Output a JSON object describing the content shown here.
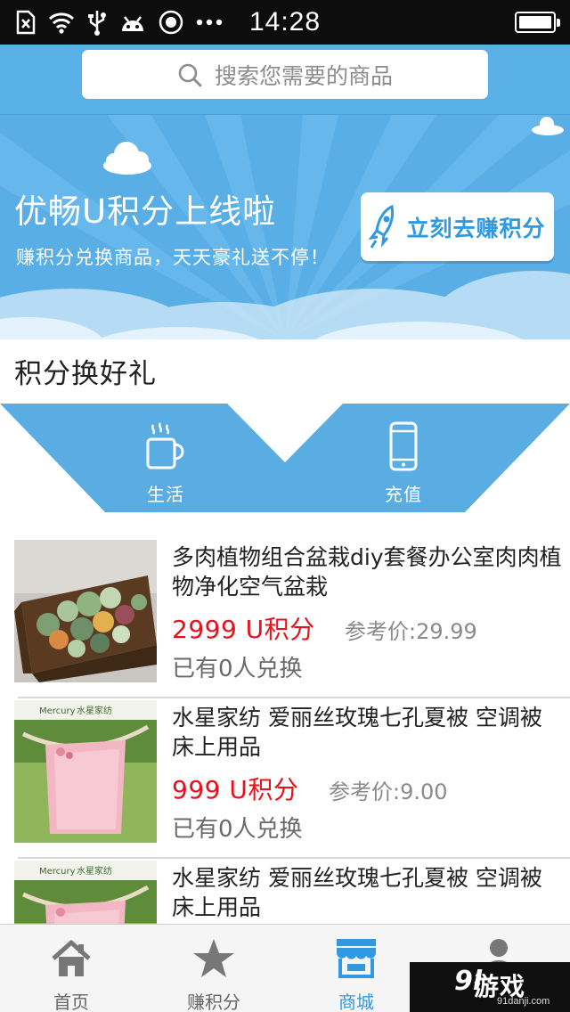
{
  "status_bar": {
    "time": "14:28",
    "icons": [
      "sim-icon",
      "wifi-icon",
      "usb-icon",
      "android-icon",
      "browser-icon",
      "more-icon",
      "battery-icon"
    ]
  },
  "search": {
    "placeholder": "搜索您需要的商品",
    "icon": "search-icon"
  },
  "banner": {
    "title": "优畅U积分上线啦",
    "subtitle": "赚积分兑换商品，天天豪礼送不停！",
    "button_label": "立刻去赚积分",
    "button_icon": "rocket-icon",
    "background_color": "#59aee6"
  },
  "section": {
    "title": "积分换好礼"
  },
  "categories": [
    {
      "label": "生活",
      "icon": "coffee-cup-icon"
    },
    {
      "label": "充值",
      "icon": "phone-icon"
    }
  ],
  "products": [
    {
      "name": "多肉植物组合盆栽diy套餐办公室肉肉植物净化空气盆栽",
      "price": "2999 U积分",
      "reference_price": "参考价:29.99",
      "redeemed": "已有0人兑换",
      "image": "succulent-planter"
    },
    {
      "name": "水星家纺 爱丽丝玫瑰七孔夏被 空调被 床上用品",
      "price": "999 U积分",
      "reference_price": "参考价:9.00",
      "redeemed": "已有0人兑换",
      "image": "pink-quilt",
      "image_label": "水星家纺"
    },
    {
      "name": "水星家纺 爱丽丝玫瑰七孔夏被 空调被 床上用品",
      "image": "pink-quilt",
      "image_label": "水星家纺"
    }
  ],
  "tab_bar": {
    "items": [
      {
        "label": "首页",
        "icon": "home-icon",
        "active": false
      },
      {
        "label": "赚积分",
        "icon": "star-icon",
        "active": false
      },
      {
        "label": "商城",
        "icon": "store-icon",
        "active": true
      },
      {
        "label": "",
        "icon": "user-icon",
        "active": false
      }
    ],
    "active_color": "#2f9ae3"
  },
  "watermark": {
    "number": "9l",
    "text": "游戏",
    "domain": "91danji.com"
  },
  "colors": {
    "accent": "#2f9ae3",
    "price": "#e8101a",
    "header_blue": "#5ab1e8"
  }
}
